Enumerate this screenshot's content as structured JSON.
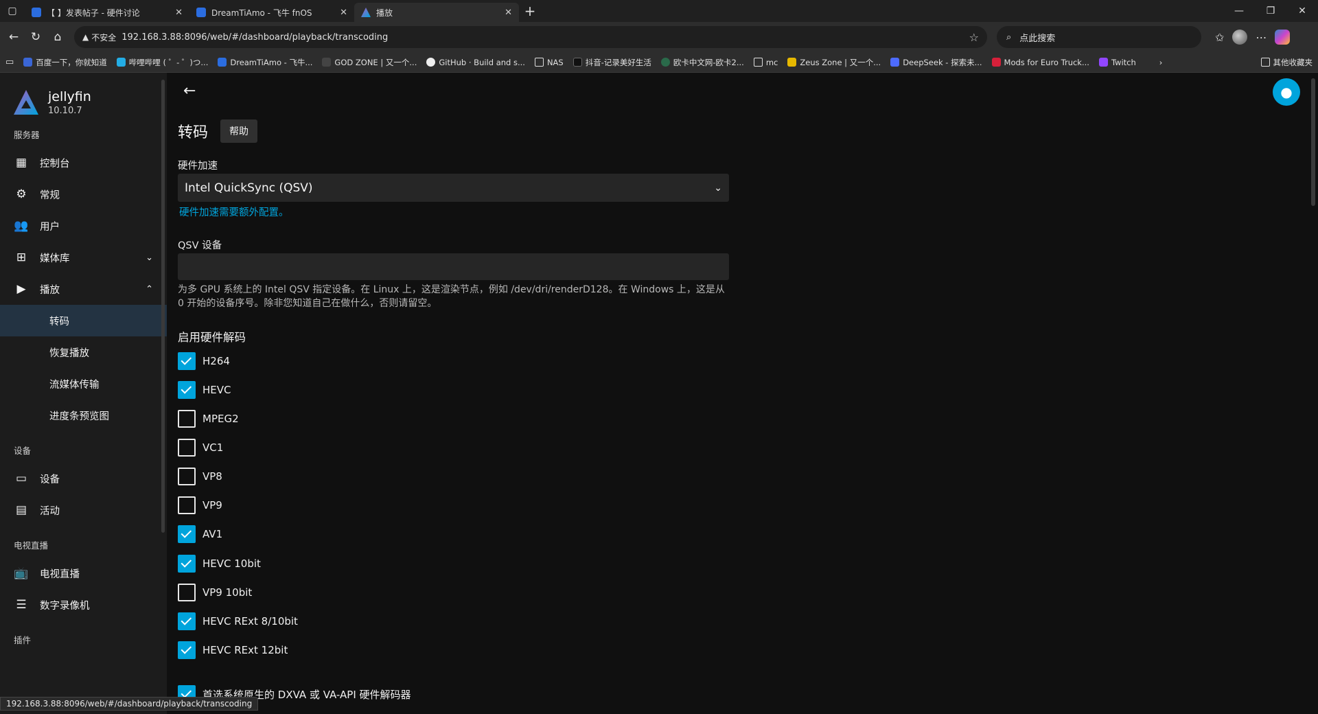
{
  "browser": {
    "tabs": [
      {
        "title": "【 】发表帖子 - 硬件讨论",
        "favicon": "forum-icon",
        "active": false
      },
      {
        "title": "DreamTiAmo - 飞牛 fnOS",
        "favicon": "forum-icon",
        "active": false
      },
      {
        "title": "播放",
        "favicon": "jellyfin-icon",
        "active": true
      }
    ],
    "new_tab": "+",
    "address": {
      "security_label": "不安全",
      "url": "192.168.3.88:8096/web/#/dashboard/playback/transcoding"
    },
    "search_placeholder": "点此搜索",
    "bookmarks": [
      {
        "label": "百度一下，你就知道",
        "color": "#3a66d6"
      },
      {
        "label": "哔哩哔哩 ( ゜- ゜)つ...",
        "color": "#23ade5"
      },
      {
        "label": "DreamTiAmo - 飞牛...",
        "color": "#2b6de0"
      },
      {
        "label": "GOD ZONE | 又一个...",
        "color": "#444444"
      },
      {
        "label": "GitHub · Build and s...",
        "color": "#eeeeee"
      },
      {
        "label": "NAS",
        "color": "folder"
      },
      {
        "label": "抖音-记录美好生活",
        "color": "#111111"
      },
      {
        "label": "欧卡中文网-欧卡2...",
        "color": "#2a6a4a"
      },
      {
        "label": "mc",
        "color": "folder"
      },
      {
        "label": "Zeus Zone | 又一个...",
        "color": "#e6b800"
      },
      {
        "label": "DeepSeek - 探索未...",
        "color": "#4d6bfe"
      },
      {
        "label": "Mods for Euro Truck...",
        "color": "#d6203a"
      },
      {
        "label": "Twitch",
        "color": "#9146ff"
      }
    ],
    "other_bookmarks": "其他收藏夹",
    "status_url": "192.168.3.88:8096/web/#/dashboard/playback/transcoding"
  },
  "sidebar": {
    "app_name": "jellyfin",
    "version": "10.10.7",
    "sections": {
      "server": "服务器",
      "devices": "设备",
      "livetv": "电视直播",
      "plugins": "插件"
    },
    "server_items": [
      {
        "label": "控制台",
        "icon": "dashboard-icon"
      },
      {
        "label": "常规",
        "icon": "gear-icon"
      },
      {
        "label": "用户",
        "icon": "people-icon"
      },
      {
        "label": "媒体库",
        "icon": "library-icon"
      },
      {
        "label": "播放",
        "icon": "play-circle-icon"
      }
    ],
    "playback_sub": [
      {
        "label": "转码",
        "active": true
      },
      {
        "label": "恢复播放",
        "active": false
      },
      {
        "label": "流媒体传输",
        "active": false
      },
      {
        "label": "进度条预览图",
        "active": false
      }
    ],
    "device_items": [
      {
        "label": "设备",
        "icon": "devices-icon"
      },
      {
        "label": "活动",
        "icon": "activity-icon"
      }
    ],
    "livetv_items": [
      {
        "label": "电视直播",
        "icon": "tv-icon"
      },
      {
        "label": "数字录像机",
        "icon": "dvr-icon"
      }
    ]
  },
  "main": {
    "title": "转码",
    "help_label": "帮助",
    "hw_accel": {
      "label": "硬件加速",
      "value": "Intel QuickSync (QSV)",
      "link": "硬件加速需要额外配置。"
    },
    "qsv_device": {
      "label": "QSV 设备",
      "value": "",
      "description": "为多 GPU 系统上的 Intel QSV 指定设备。在 Linux 上，这是渲染节点，例如 /dev/dri/renderD128。在 Windows 上，这是从 0 开始的设备序号。除非您知道自己在做什么，否则请留空。"
    },
    "hw_decoding_title": "启用硬件解码",
    "codecs": [
      {
        "label": "H264",
        "checked": true
      },
      {
        "label": "HEVC",
        "checked": true
      },
      {
        "label": "MPEG2",
        "checked": false
      },
      {
        "label": "VC1",
        "checked": false
      },
      {
        "label": "VP8",
        "checked": false
      },
      {
        "label": "VP9",
        "checked": false
      },
      {
        "label": "AV1",
        "checked": true
      },
      {
        "label": "HEVC 10bit",
        "checked": true
      },
      {
        "label": "VP9 10bit",
        "checked": false
      },
      {
        "label": "HEVC RExt 8/10bit",
        "checked": true
      },
      {
        "label": "HEVC RExt 12bit",
        "checked": true
      },
      {
        "label": "首选系统原生的 DXVA 或 VA-API 硬件解码器",
        "checked": true
      }
    ]
  },
  "colors": {
    "accent": "#00a4dc",
    "active_nav_bg": "#233342",
    "sidebar_bg": "#1c1c1c",
    "main_bg": "#101010"
  }
}
